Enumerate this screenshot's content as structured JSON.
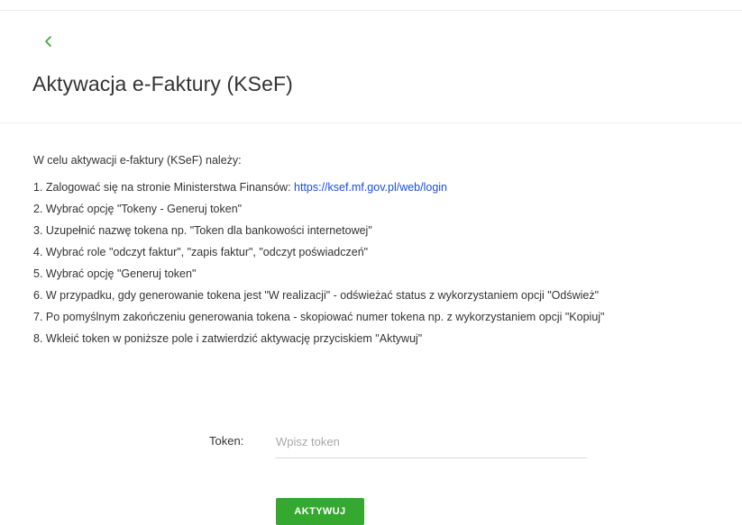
{
  "header": {
    "back_icon": "chevron-left-icon",
    "title": "Aktywacja e-Faktury (KSeF)"
  },
  "instructions": {
    "intro": "W celu aktywacji e-faktury (KSeF) należy:",
    "step1_text": "1. Zalogować się na stronie Ministerstwa Finansów: ",
    "step1_link": "https://ksef.mf.gov.pl/web/login",
    "steps": [
      "2. Wybrać opcję \"Tokeny - Generuj token\"",
      "3. Uzupełnić nazwę tokena np. \"Token dla bankowości internetowej\"",
      "4. Wybrać role \"odczyt faktur\", \"zapis faktur\", \"odczyt poświadczeń\"",
      "5. Wybrać opcję \"Generuj token\"",
      "6. W przypadku, gdy generowanie tokena jest \"W realizacji\" - odświeżać status z wykorzystaniem opcji \"Odśwież\"",
      "7. Po pomyślnym zakończeniu generowania tokena - skopiować numer tokena np. z wykorzystaniem opcji \"Kopiuj\"",
      "8. Wkleić token w poniższe pole i zatwierdzić aktywację przyciskiem \"Aktywuj\""
    ]
  },
  "form": {
    "token_label": "Token:",
    "token_placeholder": "Wpisz token",
    "token_value": "",
    "submit_label": "AKTYWUJ"
  },
  "colors": {
    "accent_green": "#35a82f",
    "link_blue": "#1a4fd6"
  }
}
